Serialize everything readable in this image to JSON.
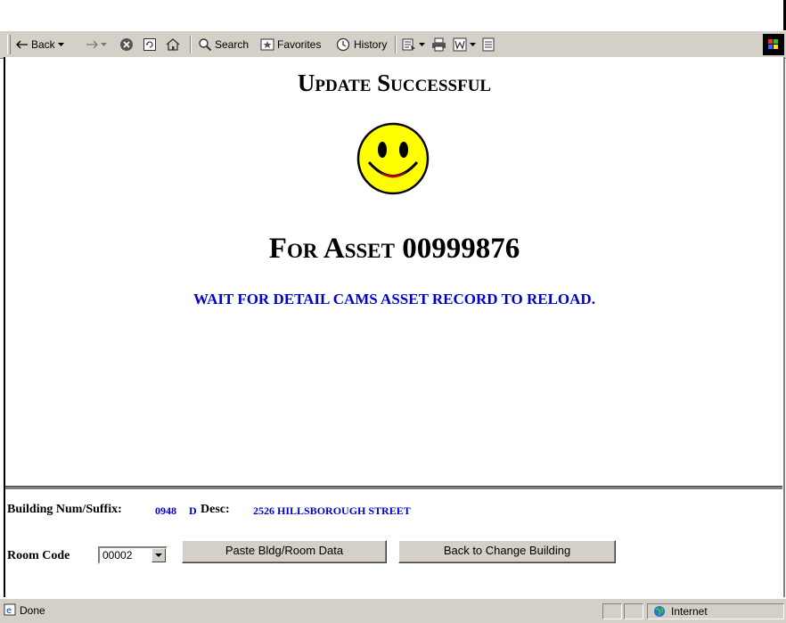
{
  "toolbar": {
    "back_label": "Back",
    "search_label": "Search",
    "favorites_label": "Favorites",
    "history_label": "History"
  },
  "page": {
    "title": "Update Successful",
    "asset_prefix": "For Asset",
    "asset_number": "00999876",
    "message": "WAIT FOR DETAIL CAMS ASSET RECORD TO RELOAD."
  },
  "form": {
    "building_label": "Building Num/Suffix:",
    "building_num": "0948",
    "building_suffix": "D",
    "desc_label": "Desc:",
    "desc_value": "2526 HILLSBOROUGH STREET",
    "room_label": "Room Code",
    "room_value": "00002",
    "paste_button": "Paste Bldg/Room Data",
    "back_button": "Back to Change Building"
  },
  "status": {
    "text": "Done",
    "zone": "Internet"
  },
  "colors": {
    "accent_blue": "#0000cc",
    "chrome_gray": "#d4d0c8",
    "smiley_yellow": "#ffff00"
  }
}
